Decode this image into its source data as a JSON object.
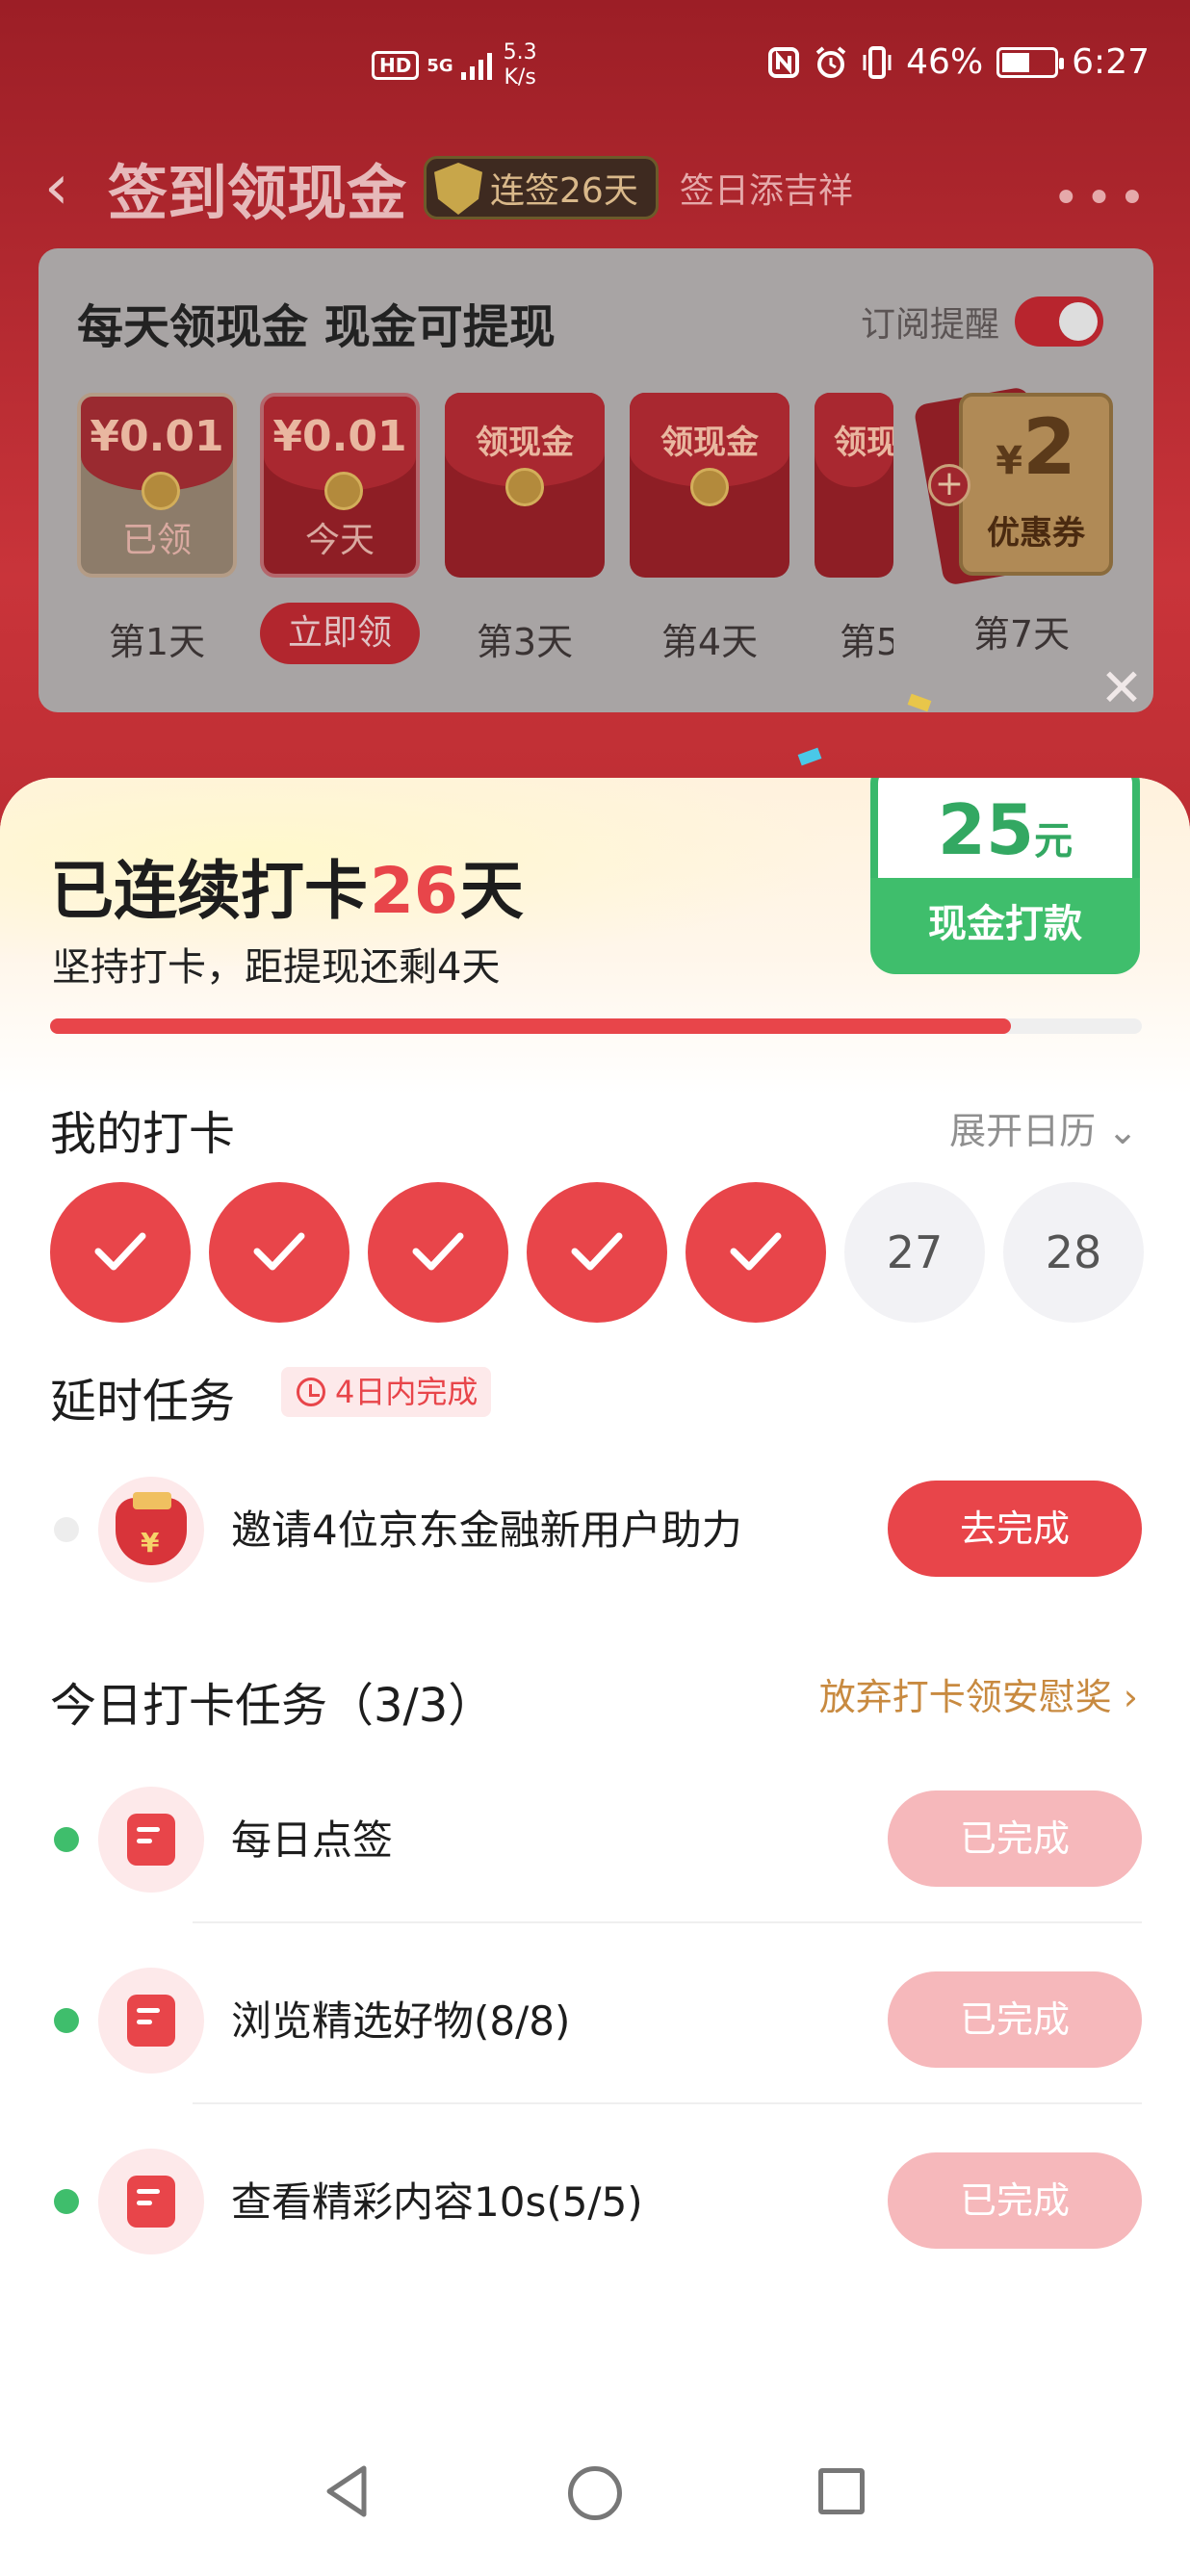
{
  "status_bar": {
    "hd": "HD",
    "net": "5G",
    "speed_value": "5.3",
    "speed_unit": "K/s",
    "battery": "46%",
    "time": "6:27"
  },
  "nav": {
    "back": "‹",
    "title": "签到领现金",
    "streak_badge": "连签26天",
    "subtitle": "签日添吉祥",
    "more": "•••"
  },
  "card": {
    "title": "每天领现金 现金可提现",
    "remind_label": "订阅提醒",
    "envelopes": [
      {
        "amount": "¥0.01",
        "status": "已领",
        "day": "第1天"
      },
      {
        "amount": "¥0.01",
        "status": "今天",
        "day": "立即领"
      },
      {
        "amount": "领现金",
        "status": "",
        "day": "第3天"
      },
      {
        "amount": "领现金",
        "status": "",
        "day": "第4天"
      },
      {
        "amount": "领现",
        "status": "",
        "day": "第5"
      }
    ],
    "coupon": {
      "currency": "¥",
      "amount": "2",
      "label": "优惠券",
      "day": "第7天",
      "plus": "+"
    }
  },
  "popup": {
    "close": "✕",
    "headline_prefix": "已连续打卡",
    "headline_num": "26",
    "headline_suffix": "天",
    "subline": "坚持打卡，距提现还剩4天",
    "progress_percent": 88,
    "reward": {
      "amount": "25",
      "unit": "元",
      "label": "现金打款"
    },
    "my_checkin_title": "我的打卡",
    "expand_label": "展开日历 ⌄",
    "days": [
      {
        "done": true,
        "label": ""
      },
      {
        "done": true,
        "label": ""
      },
      {
        "done": true,
        "label": ""
      },
      {
        "done": true,
        "label": ""
      },
      {
        "done": true,
        "label": ""
      },
      {
        "done": false,
        "label": "27"
      },
      {
        "done": false,
        "label": "28"
      }
    ],
    "delay_title": "延时任务",
    "delay_badge": "4日内完成",
    "delay_task": {
      "label": "邀请4位京东金融新用户助力",
      "button": "去完成"
    },
    "today_title": "今日打卡任务（3/3）",
    "give_up": "放弃打卡领安慰奖 ›",
    "today_tasks": [
      {
        "label": "每日点签",
        "button": "已完成"
      },
      {
        "label": "浏览精选好物(8/8)",
        "button": "已完成"
      },
      {
        "label": "查看精彩内容10s(5/5)",
        "button": "已完成"
      }
    ]
  },
  "colors": {
    "accent": "#e8454a",
    "success": "#3fbe6c",
    "done_button": "#f6b8bb",
    "link": "#c88a40"
  }
}
